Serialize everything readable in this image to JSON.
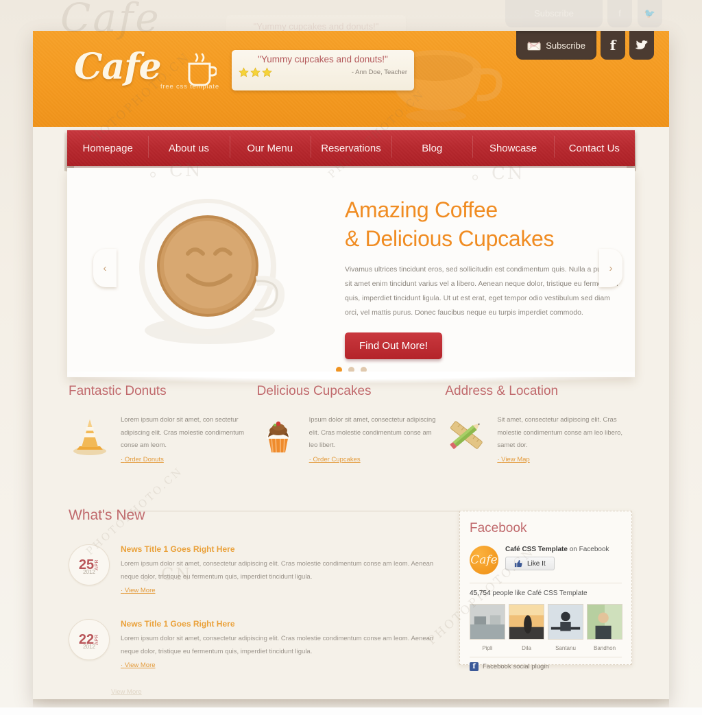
{
  "meta": {
    "accent_orange": "#f08c22",
    "accent_red": "#b4242a",
    "heading_rose": "#c0696c",
    "header_bg": "#f59a1f"
  },
  "ghost": {
    "testimonial": "\"Yummy cupcakes and donuts!\"",
    "subscribe": "Subscribe",
    "facebook_icon": "f",
    "twitter_icon": "✐"
  },
  "header": {
    "logo_word": "Cafe",
    "logo_tagline": "free css template",
    "testimonial": {
      "quote": "\"Yummy cupcakes and donuts!\"",
      "author": "- Ann Doe, Teacher",
      "stars": 3
    },
    "subscribe_label": "Subscribe",
    "facebook_label": "f",
    "twitter_label": "t"
  },
  "nav": {
    "items": [
      {
        "label": "Homepage"
      },
      {
        "label": "About us"
      },
      {
        "label": "Our Menu"
      },
      {
        "label": "Reservations"
      },
      {
        "label": "Blog"
      },
      {
        "label": "Showcase"
      },
      {
        "label": "Contact Us"
      }
    ]
  },
  "hero": {
    "title_line1": "Amazing Coffee",
    "title_line2": "& Delicious Cupcakes",
    "paragraph": "Vivamus ultrices tincidunt eros, sed sollicitudin est condimentum quis. Nulla a purus sit amet enim tincidunt varius vel a libero. Aenean neque dolor, tristique eu fermentum quis, imperdiet tincidunt ligula. Ut ut est erat, eget tempor odio vestibulum sed diam orci, vel mattis purus. Donec faucibus neque eu turpis imperdiet commodo.",
    "button_label": "Find Out More!",
    "prev_arrow": "‹",
    "next_arrow": "›",
    "slide_count": 3,
    "active_slide": 1
  },
  "features": [
    {
      "title": "Fantastic Donuts",
      "icon": "traffic-cone-icon",
      "text": "Lorem ipsum dolor sit amet, con sectetur adipiscing elit. Cras molestie condimentum conse am leom.",
      "link": "Order Donuts"
    },
    {
      "title": "Delicious Cupcakes",
      "icon": "cupcake-icon",
      "text": "Ipsum dolor sit amet, consectetur adipiscing elit. Cras molestie condimentum conse am leo libert.",
      "link": "Order Cupcakes"
    },
    {
      "title": "Address & Location",
      "icon": "ruler-pencil-icon",
      "text": "Sit amet, consectetur adipiscing elit. Cras molestie condimentum conse am leo libero, samet dor.",
      "link": "View Map"
    }
  ],
  "news": {
    "heading": "What's New",
    "items": [
      {
        "day": "25",
        "month": "APR",
        "year": "2012",
        "title": "News Title 1 Goes Right Here",
        "body": "Lorem ipsum dolor sit amet, consectetur adipiscing elit. Cras molestie condimentum conse am leom. Aenean neque dolor, tristique eu fermentum quis, imperdiet tincidunt ligula.",
        "link": "View More"
      },
      {
        "day": "22",
        "month": "APR",
        "year": "2012",
        "title": "News Title 1 Goes Right Here",
        "body": "Lorem ipsum dolor sit amet, consectetur adipiscing elit. Cras molestie condimentum conse am leom. Aenean neque dolor, tristique eu fermentum quis, imperdiet tincidunt ligula.",
        "link": "View More"
      }
    ],
    "ghost_link": "View More"
  },
  "facebook": {
    "heading": "Facebook",
    "avatar_text": "Cafe",
    "page_name": "Café CSS Template",
    "page_suffix": " on Facebook",
    "like_label": "Like It",
    "like_icon": "thumbs-up-icon",
    "count": "45,754",
    "count_text": "people like Café CSS Template",
    "friends": [
      {
        "name": "Pipli"
      },
      {
        "name": "Dila"
      },
      {
        "name": "Santanu"
      },
      {
        "name": "Bandhon"
      }
    ],
    "plugin_label": "Facebook social plugin"
  },
  "watermarks": {
    "brand": "Cafe",
    "photo": "PHOTOPHOTO.CN",
    "cn": ".CN"
  }
}
